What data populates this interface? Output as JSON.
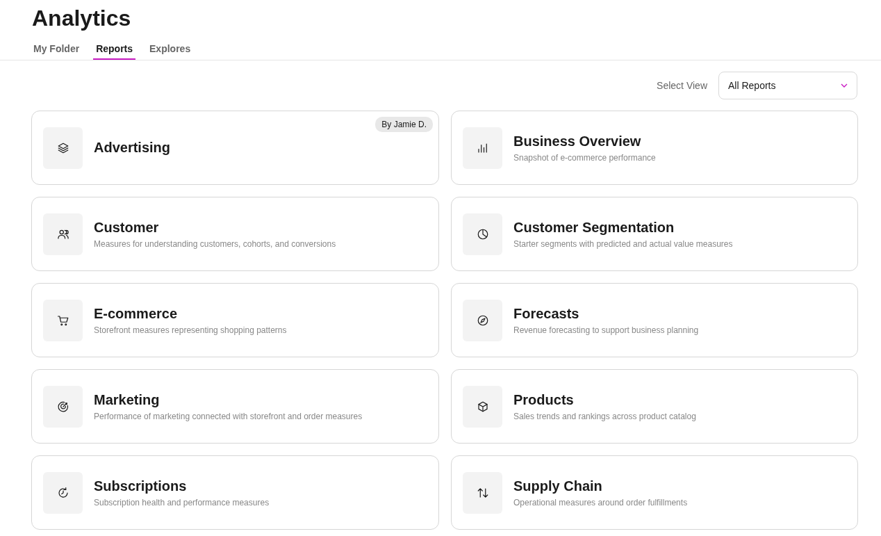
{
  "page_title": "Analytics",
  "tabs": [
    {
      "label": "My Folder",
      "selected": false
    },
    {
      "label": "Reports",
      "selected": true
    },
    {
      "label": "Explores",
      "selected": false
    }
  ],
  "view_select": {
    "label": "Select View",
    "value": "All Reports"
  },
  "reports": [
    {
      "kind": "layers",
      "title": "Advertising",
      "badge": "By Jamie D."
    },
    {
      "kind": "bars",
      "title": "Business Overview",
      "description": "Snapshot of e-commerce performance"
    },
    {
      "kind": "people",
      "title": "Customer",
      "description": "Measures for understanding customers, cohorts, and conversions"
    },
    {
      "kind": "pie",
      "title": "Customer Segmentation",
      "description": "Starter segments with predicted and actual value measures"
    },
    {
      "kind": "cart",
      "title": "E-commerce",
      "description": "Storefront measures representing shopping patterns"
    },
    {
      "kind": "compass",
      "title": "Forecasts",
      "description": "Revenue forecasting to support business planning"
    },
    {
      "kind": "target",
      "title": "Marketing",
      "description": "Performance of marketing connected with storefront and order measures"
    },
    {
      "kind": "cube",
      "title": "Products",
      "description": "Sales trends and rankings across product catalog"
    },
    {
      "kind": "renew",
      "title": "Subscriptions",
      "description": "Subscription health and performance measures"
    },
    {
      "kind": "swap",
      "title": "Supply Chain",
      "description": "Operational measures around order fulfillments"
    }
  ]
}
